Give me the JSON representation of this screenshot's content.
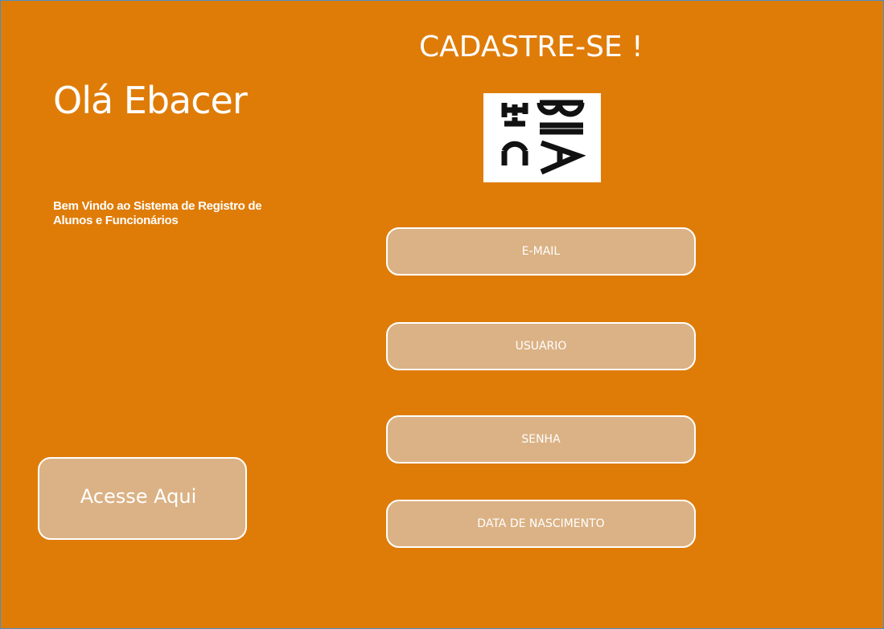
{
  "welcome_panel": {
    "greeting": "Olá Ebacer",
    "message": "Bem Vindo ao Sistema de Registro de Alunos e Funcionários",
    "access_button_label": "Acesse Aqui"
  },
  "signup_form": {
    "title": "CADASTRE-SE !",
    "logo_icon": "ebac-logo",
    "fields": {
      "email": {
        "placeholder": "E-MAIL",
        "value": ""
      },
      "username": {
        "placeholder": "USUÁRIO",
        "value": ""
      },
      "password": {
        "placeholder": "SENHA",
        "value": ""
      },
      "birthdate": {
        "placeholder": "DATA DE NASCIMENTO",
        "value": ""
      }
    }
  },
  "colors": {
    "background": "#df7c08",
    "field_fill": "#dbb285",
    "text": "#ffffff",
    "border": "#ffffff"
  }
}
